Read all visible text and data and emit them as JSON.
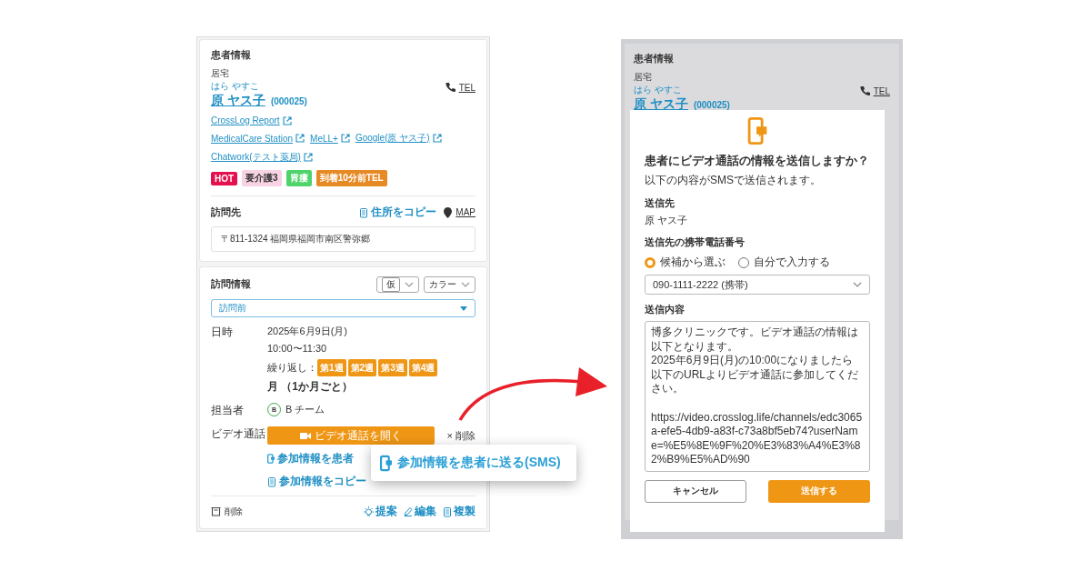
{
  "patient_panel": {
    "title": "患者情報",
    "residence": "居宅",
    "name_kana": "はら やすこ",
    "name": "原 ヤス子",
    "patient_id": "(000025)",
    "tel_link": "TEL",
    "link_rows": [
      {
        "links": [
          "CrossLog Report"
        ]
      },
      {
        "links": [
          "MedicalCare Station",
          "MeLL+",
          "Google(原 ヤス子)"
        ]
      },
      {
        "links": [
          "Chatwork(テスト薬局)"
        ]
      }
    ],
    "tags": [
      {
        "label": "HOT",
        "color": "#e5114f"
      },
      {
        "label": "要介護3",
        "color": "#f8d3e4"
      },
      {
        "label": "胃瘻",
        "color": "#4fd46c"
      },
      {
        "label": "到着10分前TEL",
        "color": "#e68a26"
      }
    ],
    "visit_place": {
      "title": "訪問先",
      "copy_link": "住所をコピー",
      "map_link": "MAP",
      "address": "〒811-1324 福岡県福岡市南区警弥郷"
    }
  },
  "visit_panel": {
    "title": "訪問情報",
    "tentative_select": "仮",
    "color_select": "カラー",
    "status_select": "訪問前",
    "date_label": "日時",
    "date": "2025年6月9日(月)",
    "time": "10:00〜11:30",
    "repeat_label": "繰り返し：",
    "repeat_weeks": [
      "第1週",
      "第2週",
      "第3週",
      "第4週"
    ],
    "repeat_suffix": "月 （1か月ごと）",
    "staff_label": "担当者",
    "staff_badge": "B",
    "staff": "B チーム",
    "video_label": "ビデオ通話",
    "open_video_button": "ビデオ通話を開く",
    "delete_video": "× 削除",
    "send_link": "参加情報を患者",
    "copy_link": "参加情報をコピー",
    "footer": {
      "delete": "削除",
      "suggest": "提案",
      "edit": "編集",
      "duplicate": "複製"
    }
  },
  "callout": {
    "label": "参加情報を患者に送る(SMS)"
  },
  "modal_screen": {
    "background": {
      "title": "患者情報",
      "residence": "居宅",
      "name_kana": "はら やすこ",
      "name": "原 ヤス子",
      "patient_id": "(000025)",
      "tel_link": "TEL"
    },
    "dialog": {
      "title": "患者にビデオ通話の情報を送信しますか？",
      "subtitle": "以下の内容がSMSで送信されます。",
      "recipient_label": "送信先",
      "recipient": "原 ヤス子",
      "phone_label": "送信先の携帯電話番号",
      "phone_options": [
        {
          "label": "候補から選ぶ",
          "selected": true
        },
        {
          "label": "自分で入力する",
          "selected": false
        }
      ],
      "phone_select": "090-1111-2222 (携帯)",
      "message_label": "送信内容",
      "message": "博多クリニックです。ビデオ通話の情報は以下となります。\n2025年6月9日(月)の10:00になりましたら以下のURLよりビデオ通話に参加してください。\n\nhttps://video.crosslog.life/channels/edc3065a-efe5-4db9-a83f-c73a8bf5eb74?userName=%E5%8E%9F%20%E3%83%A4%E3%82%B9%E5%AD%90",
      "buttons": [
        {
          "label": "キャンセル",
          "kind": "secondary"
        },
        {
          "label": "送信する",
          "kind": "primary"
        }
      ]
    }
  }
}
